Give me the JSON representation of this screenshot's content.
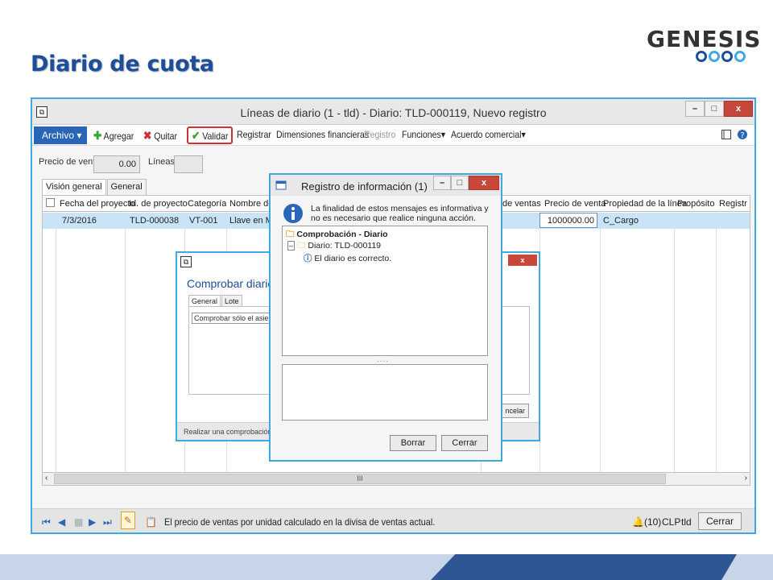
{
  "slide": {
    "title": "Diario de cuota",
    "logo_text": "GENESIS",
    "logo_ring_colors": [
      "#1f4e99",
      "#3fa9e0",
      "#1f4e99",
      "#3fa9e0"
    ]
  },
  "main_window": {
    "title": "Líneas de diario (1 - tld) - Diario: TLD-000119, Nuevo registro",
    "icon": "window-icon",
    "toolbar": {
      "archivo": "Archivo",
      "agregar": "Agregar",
      "quitar": "Quitar",
      "validar": "Validar",
      "registrar": "Registrar",
      "dimensiones": "Dimensiones financieras",
      "registro": "Registro",
      "funciones": "Funciones",
      "acuerdo": "Acuerdo comercial"
    },
    "fields": {
      "precio_label": "Precio de venta:",
      "precio_value": "0.00",
      "lineas_label": "Líneas:",
      "lineas_value": ""
    },
    "tabs": [
      "Visión general",
      "General"
    ],
    "grid": {
      "headers": [
        "Fecha del proyecto",
        "Id. de proyecto",
        "Categoría",
        "Nombre de c",
        "de ventas",
        "Precio de venta",
        "Propiedad de la línea",
        "Propósito",
        "Registr"
      ],
      "row": {
        "fecha": "7/3/2016",
        "proyecto": "TLD-000038",
        "categoria": "VT-001",
        "nombre": "Llave en Man",
        "precio": "1000000.00",
        "propiedad": "C_Cargo"
      }
    },
    "scroll_label": "III",
    "status": {
      "text": "El precio de ventas por unidad calculado en la divisa de ventas actual.",
      "notifications": "(10)",
      "currency": "CLP",
      "company": "tld",
      "close": "Cerrar"
    }
  },
  "comprobar_dialog": {
    "title": "Comprobar diario TL",
    "tabs": [
      "General",
      "Lote"
    ],
    "field": "Comprobar sólo el asiento",
    "status": "Realizar una comprobación só",
    "cancel": "ncelar",
    "close_glyph": "x"
  },
  "infolog": {
    "title": "Registro de información (1)",
    "message": "La finalidad de estos mensajes es informativa y no es necesario que realice ninguna acción.",
    "tree": {
      "root": "Comprobación - Diario",
      "child": "Diario: TLD-000119",
      "leaf": "El diario es correcto."
    },
    "splitter": "....",
    "buttons": {
      "borrar": "Borrar",
      "cerrar": "Cerrar"
    }
  },
  "window_controls": {
    "minimize": "–",
    "maximize": "□",
    "close": "x"
  }
}
